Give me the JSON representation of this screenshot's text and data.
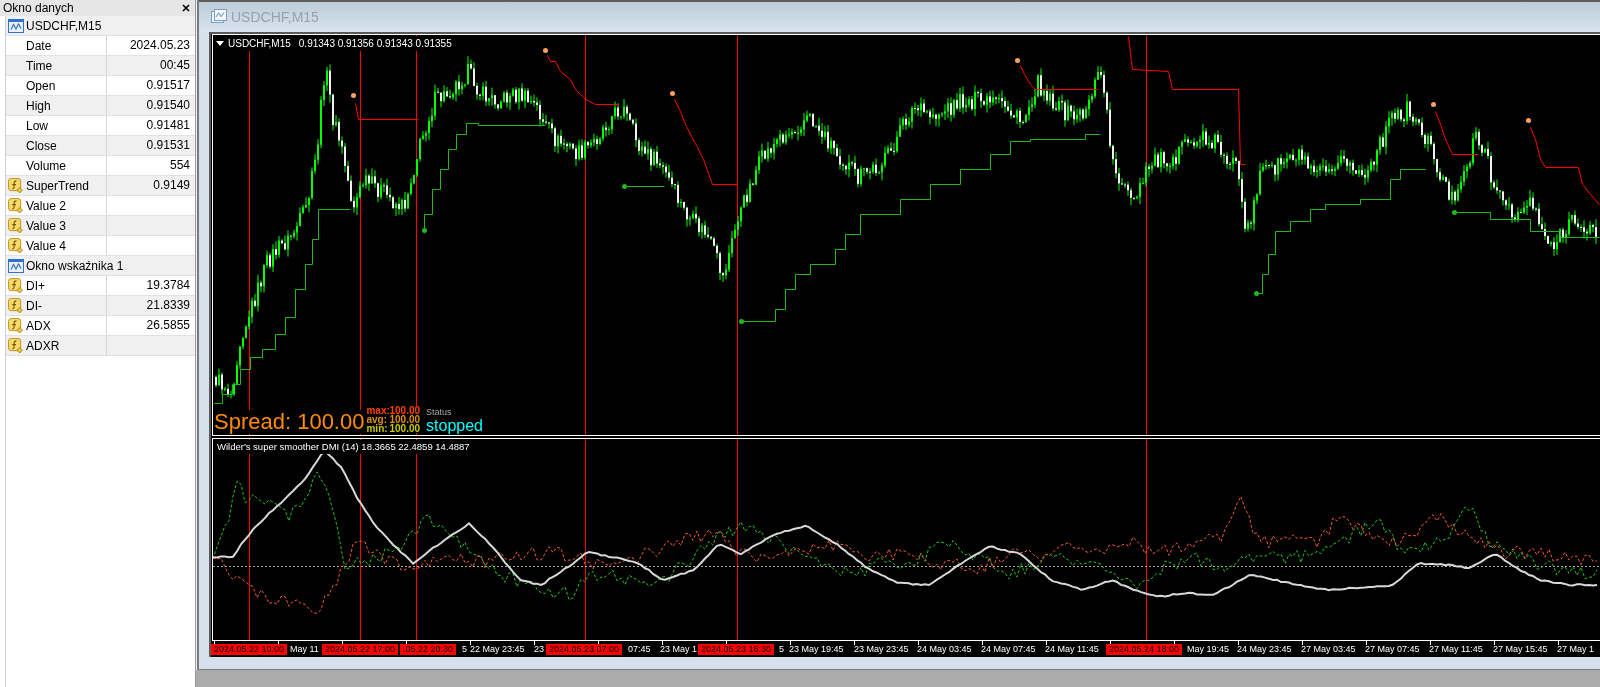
{
  "data_window": {
    "title": "Okno danych",
    "sections": [
      {
        "title": "USDCHF,M15",
        "rows": [
          {
            "kind": "field",
            "label": "Date",
            "value": "2024.05.23"
          },
          {
            "kind": "field",
            "label": "Time",
            "value": "00:45"
          },
          {
            "kind": "field",
            "label": "Open",
            "value": "0.91517"
          },
          {
            "kind": "field",
            "label": "High",
            "value": "0.91540"
          },
          {
            "kind": "field",
            "label": "Low",
            "value": "0.91481"
          },
          {
            "kind": "field",
            "label": "Close",
            "value": "0.91531"
          },
          {
            "kind": "field",
            "label": "Volume",
            "value": "554"
          },
          {
            "kind": "indicator",
            "label": "SuperTrend",
            "value": "0.9149"
          },
          {
            "kind": "indicator",
            "label": "Value 2"
          },
          {
            "kind": "indicator",
            "label": "Value 3"
          },
          {
            "kind": "indicator",
            "label": "Value 4"
          }
        ]
      },
      {
        "title": "Okno wskaźnika 1",
        "rows": [
          {
            "kind": "indicator",
            "label": "DI+",
            "value": "19.3784"
          },
          {
            "kind": "indicator",
            "label": "DI-",
            "value": "21.8339"
          },
          {
            "kind": "indicator",
            "label": "ADX",
            "value": "26.5855"
          },
          {
            "kind": "indicator",
            "label": "ADXR"
          }
        ]
      }
    ]
  },
  "chart_window": {
    "title": "USDCHF,M15",
    "header": {
      "symbol": "USDCHF,M15",
      "quotes": "0.91343 0.91356 0.91343 0.91355"
    },
    "spread_panel": {
      "spread": "Spread: 100.00",
      "stats": [
        {
          "label": "max:",
          "value": "100.00",
          "color": "#ff4000"
        },
        {
          "label": "avg:",
          "value": "100.00",
          "color": "#e09000"
        },
        {
          "label": "min:",
          "value": "100.00",
          "color": "#c8c800"
        }
      ],
      "status_label": "Status",
      "status": "stopped"
    },
    "indicator": {
      "title": "Wilder's super smoother DMI (14) 18.3665 22.4859 14.4887"
    },
    "time_axis": [
      {
        "kind": "marker",
        "label": "2024.05.22 10:00"
      },
      {
        "kind": "label",
        "label": "May 11"
      },
      {
        "kind": "marker",
        "label": "2024.05.22 17:00"
      },
      {
        "kind": "marker",
        "label": ".05.22 20:30"
      },
      {
        "kind": "label",
        "label": "5"
      },
      {
        "kind": "label",
        "label": "22 May 23:45"
      },
      {
        "kind": "label",
        "label": "23"
      },
      {
        "kind": "marker",
        "label": "2024.05.23 07:00"
      },
      {
        "kind": "label",
        "label": "07:45"
      },
      {
        "kind": "label",
        "label": "23 May 1"
      },
      {
        "kind": "marker",
        "label": "2024.05.23 16:30"
      },
      {
        "kind": "label",
        "label": "5"
      },
      {
        "kind": "label",
        "label": "23 May 19:45"
      },
      {
        "kind": "label",
        "label": "23 May 23:45"
      },
      {
        "kind": "label",
        "label": "24 May 03:45"
      },
      {
        "kind": "label",
        "label": "24 May 07:45"
      },
      {
        "kind": "label",
        "label": "24 May 11:45"
      },
      {
        "kind": "marker",
        "label": "2024.05.24 18:00"
      },
      {
        "kind": "label",
        "label": "May 19:45"
      },
      {
        "kind": "label",
        "label": "24 May 23:45"
      },
      {
        "kind": "label",
        "label": "27 May 03:45"
      },
      {
        "kind": "label",
        "label": "27 May 07:45"
      },
      {
        "kind": "label",
        "label": "27 May 11:45"
      },
      {
        "kind": "label",
        "label": "27 May 15:45"
      },
      {
        "kind": "label",
        "label": "27 May 1"
      }
    ]
  }
}
